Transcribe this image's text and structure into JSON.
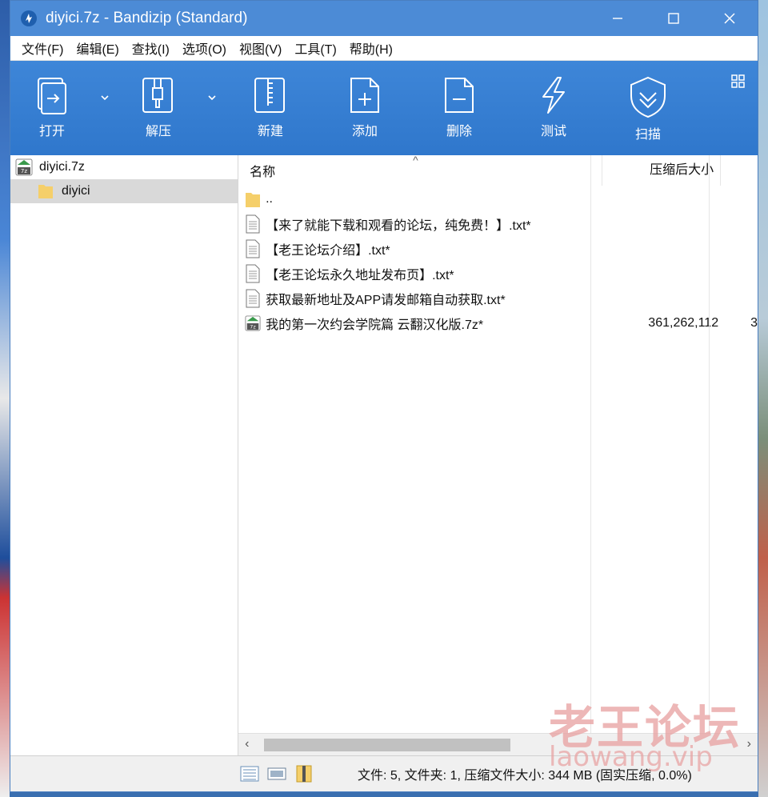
{
  "window": {
    "title": "diyici.7z - Bandizip (Standard)"
  },
  "menu": [
    "文件(F)",
    "编辑(E)",
    "查找(I)",
    "选项(O)",
    "视图(V)",
    "工具(T)",
    "帮助(H)"
  ],
  "toolbar": {
    "open": "打开",
    "extract": "解压",
    "new": "新建",
    "add": "添加",
    "delete": "删除",
    "test": "测试",
    "scan": "扫描"
  },
  "tree": {
    "root": "diyici.7z",
    "child": "diyici"
  },
  "columns": {
    "name": "名称",
    "size": "压缩后大小"
  },
  "files": [
    {
      "name": "..",
      "size": "",
      "type": "folder"
    },
    {
      "name": "【来了就能下载和观看的论坛，纯免费！】.txt*",
      "size": "",
      "type": "txt"
    },
    {
      "name": "【老王论坛介绍】.txt*",
      "size": "",
      "type": "txt"
    },
    {
      "name": "【老王论坛永久地址发布页】.txt*",
      "size": "",
      "type": "txt"
    },
    {
      "name": "获取最新地址及APP请发邮箱自动获取.txt*",
      "size": "",
      "type": "txt"
    },
    {
      "name": "我的第一次约会学院篇 云翻汉化版.7z*",
      "size": "361,262,112",
      "extra": "3",
      "type": "7z"
    }
  ],
  "status": {
    "text": "文件: 5, 文件夹: 1, 压缩文件大小: 344 MB (固实压缩, 0.0%)"
  },
  "watermark": {
    "cn": "老王论坛",
    "url": "laowang.vip"
  },
  "colors": {
    "titlebar": "#4c8bd6",
    "toolbar": "#3e86d8",
    "folder": "#f5cf6a"
  }
}
